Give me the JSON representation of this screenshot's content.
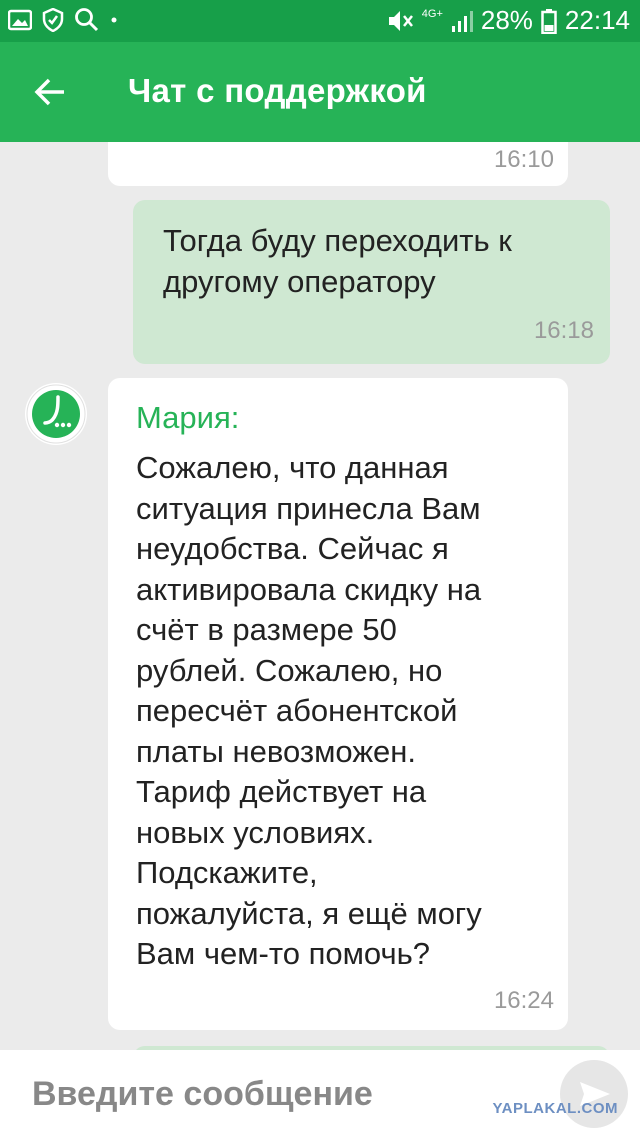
{
  "status_bar": {
    "signal_label": "4G+",
    "battery": "28%",
    "time": "22:14"
  },
  "app_bar": {
    "title": "Чат с поддержкой"
  },
  "messages": [
    {
      "direction": "incoming",
      "time": "16:10"
    },
    {
      "direction": "outgoing",
      "text": [
        "Тогда буду переходить к",
        "другому оператору"
      ],
      "time": "16:18"
    },
    {
      "direction": "incoming",
      "sender": "Мария:",
      "text": [
        "Сожалею, что данная",
        "ситуация принесла Вам",
        "неудобства. Сейчас я",
        "активировала скидку на",
        "счёт в размере 50",
        "рублей. Сожалею, но",
        "пересчёт абонентской",
        "платы невозможен.",
        "Тариф действует на",
        "новых условиях.",
        "Подскажите,",
        "пожалуйста, я ещё могу",
        "Вам чем-то помочь?"
      ],
      "time": "16:24"
    }
  ],
  "composer": {
    "placeholder": "Введите сообщение"
  },
  "watermark": "YAPLAKAL.COM",
  "colors": {
    "status_bar": "#179f49",
    "app_bar": "#26b357",
    "outgoing_bubble": "#cfe8d2",
    "incoming_bubble": "#ffffff",
    "sender_name": "#26b357"
  }
}
